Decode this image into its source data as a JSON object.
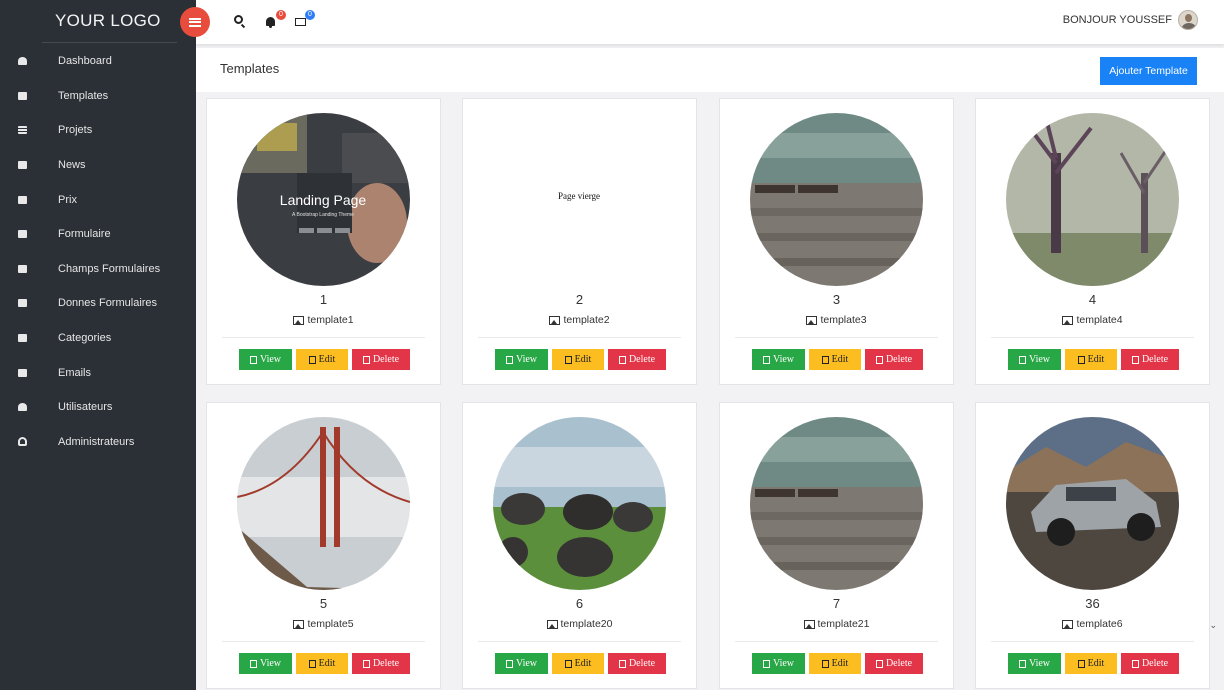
{
  "brand": {
    "logo": "YOUR LOGO"
  },
  "sidebar": {
    "items": [
      {
        "label": "Dashboard",
        "icon": "dashboard-icon"
      },
      {
        "label": "Templates",
        "icon": "image-icon"
      },
      {
        "label": "Projets",
        "icon": "list-icon"
      },
      {
        "label": "News",
        "icon": "document-icon"
      },
      {
        "label": "Prix",
        "icon": "money-icon"
      },
      {
        "label": "Formulaire",
        "icon": "grid-icon"
      },
      {
        "label": "Champs Formulaires",
        "icon": "edit-icon"
      },
      {
        "label": "Donnes Formulaires",
        "icon": "book-icon"
      },
      {
        "label": "Categories",
        "icon": "folder-icon"
      },
      {
        "label": "Emails",
        "icon": "envelope-icon"
      },
      {
        "label": "Utilisateurs",
        "icon": "users-icon"
      },
      {
        "label": "Administrateurs",
        "icon": "user-icon"
      }
    ]
  },
  "topbar": {
    "notifications_count": "0",
    "messages_count": "0",
    "greeting": "BONJOUR YOUSSEF"
  },
  "header": {
    "title": "Templates",
    "add_button": "Ajouter Template"
  },
  "actions": {
    "view": "View",
    "edit": "Edit",
    "delete": "Delete"
  },
  "templates": [
    {
      "id": "1",
      "name": "template1",
      "thumb_text": "Landing Page",
      "thumb_subtext": "A Bootstrap Landing Theme"
    },
    {
      "id": "2",
      "name": "template2",
      "thumb_text": "Page vierge"
    },
    {
      "id": "3",
      "name": "template3"
    },
    {
      "id": "4",
      "name": "template4"
    },
    {
      "id": "5",
      "name": "template5"
    },
    {
      "id": "6",
      "name": "template20"
    },
    {
      "id": "7",
      "name": "template21"
    },
    {
      "id": "36",
      "name": "template6"
    }
  ],
  "colors": {
    "sidebar_bg": "#2b2f36",
    "accent_blue": "#1a82f7",
    "menu_button": "#e74c3c",
    "view": "#27a745",
    "edit": "#fbbd20",
    "delete": "#e23547"
  }
}
